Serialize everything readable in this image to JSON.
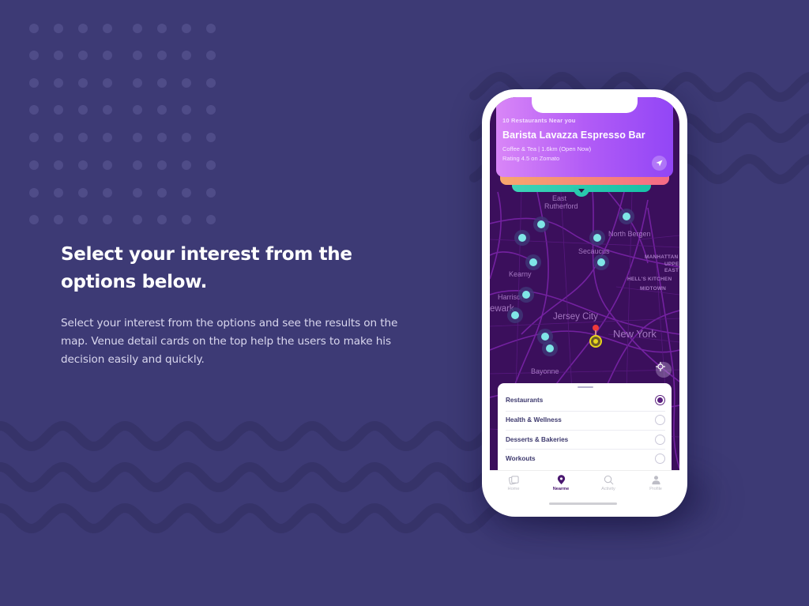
{
  "colors": {
    "background": "#3d3a75",
    "accent_purple": "#9246f6",
    "teal": "#7fe6e6",
    "map_bg": "#3b0f5c",
    "selected_radio": "#5a1f7e"
  },
  "copy": {
    "headline_line1": "Select your interest from the",
    "headline_line2": "options below.",
    "body_line1": "Select your interest from the options and see the results on the",
    "body_line2": "map. Venue detail cards on the top help the users to make his",
    "body_line3": "decision easily and quickly."
  },
  "venue_card": {
    "count_text": "10 Restaurants Near you",
    "name": "Barista Lavazza Espresso Bar",
    "meta_line1": "Coffee & Tea  |  1.6km (Open Now)",
    "meta_line2": "Rating 4.5 on Zomato",
    "navigate_icon": "navigation-arrow-icon"
  },
  "map": {
    "labels": [
      {
        "text": "East",
        "style": "normal"
      },
      {
        "text": "Rutherford",
        "style": "normal"
      },
      {
        "text": "North Bergen",
        "style": "city"
      },
      {
        "text": "Secaucus",
        "style": "normal"
      },
      {
        "text": "MANHATTAN",
        "style": "small-caps"
      },
      {
        "text": "UPPER",
        "style": "small-caps"
      },
      {
        "text": "EAST",
        "style": "small-caps"
      },
      {
        "text": "HELL'S KITCHEN",
        "style": "small-caps"
      },
      {
        "text": "MIDTOWN",
        "style": "small-caps"
      },
      {
        "text": "Kearny",
        "style": "normal"
      },
      {
        "text": "Harrison",
        "style": "normal"
      },
      {
        "text": "ewark",
        "style": "city"
      },
      {
        "text": "Jersey City",
        "style": "city"
      },
      {
        "text": "New York",
        "style": "big"
      },
      {
        "text": "Bayonne",
        "style": "normal"
      }
    ],
    "venue_count": 10,
    "locate_icon": "crosshair-icon",
    "user_pin": "current-location-pin"
  },
  "categories": {
    "options": [
      {
        "label": "Restaurants",
        "selected": true
      },
      {
        "label": "Health & Wellness",
        "selected": false
      },
      {
        "label": "Desserts & Bakeries",
        "selected": false
      },
      {
        "label": "Workouts",
        "selected": false
      }
    ]
  },
  "tabbar": {
    "tabs": [
      {
        "label": "Home",
        "icon": "home-cards-icon",
        "active": false
      },
      {
        "label": "Nearme",
        "icon": "map-pin-icon",
        "active": true
      },
      {
        "label": "Activity",
        "icon": "search-icon",
        "active": false
      },
      {
        "label": "Profile",
        "icon": "person-icon",
        "active": false
      }
    ]
  }
}
